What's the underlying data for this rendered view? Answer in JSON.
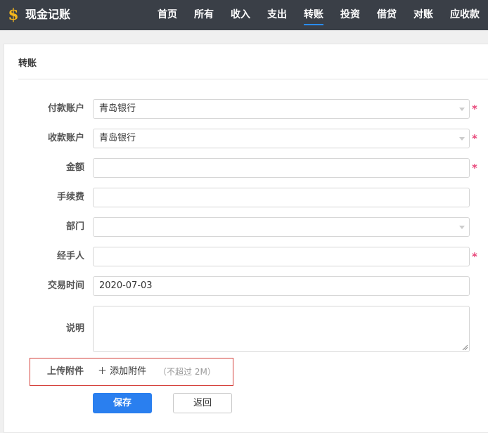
{
  "app": {
    "logo_glyph": "$",
    "title": "现金记账",
    "accent": "#2a7fef",
    "logo_color": "#f2b51c"
  },
  "nav": {
    "items": [
      {
        "label": "首页",
        "active": false
      },
      {
        "label": "所有",
        "active": false
      },
      {
        "label": "收入",
        "active": false
      },
      {
        "label": "支出",
        "active": false
      },
      {
        "label": "转账",
        "active": true
      },
      {
        "label": "投资",
        "active": false
      },
      {
        "label": "借贷",
        "active": false
      },
      {
        "label": "对账",
        "active": false
      },
      {
        "label": "应收款",
        "active": false
      }
    ]
  },
  "form": {
    "title": "转账",
    "required_mark": "*",
    "fields": [
      {
        "label": "付款账户",
        "value": "青岛银行",
        "type": "select",
        "required": true
      },
      {
        "label": "收款账户",
        "value": "青岛银行",
        "type": "select",
        "required": true
      },
      {
        "label": "金额",
        "value": "",
        "type": "text",
        "required": true
      },
      {
        "label": "手续费",
        "value": "",
        "type": "text",
        "required": false
      },
      {
        "label": "部门",
        "value": "",
        "type": "select",
        "required": false
      },
      {
        "label": "经手人",
        "value": "",
        "type": "text",
        "required": true
      },
      {
        "label": "交易时间",
        "value": "2020-07-03",
        "type": "text",
        "required": false
      },
      {
        "label": "说明",
        "value": "",
        "type": "textarea",
        "required": false
      }
    ],
    "upload": {
      "label": "上传附件",
      "add_label": "＋ 添加附件",
      "hint": "（不超过 2M）"
    },
    "buttons": {
      "save": "保存",
      "back": "返回"
    }
  }
}
